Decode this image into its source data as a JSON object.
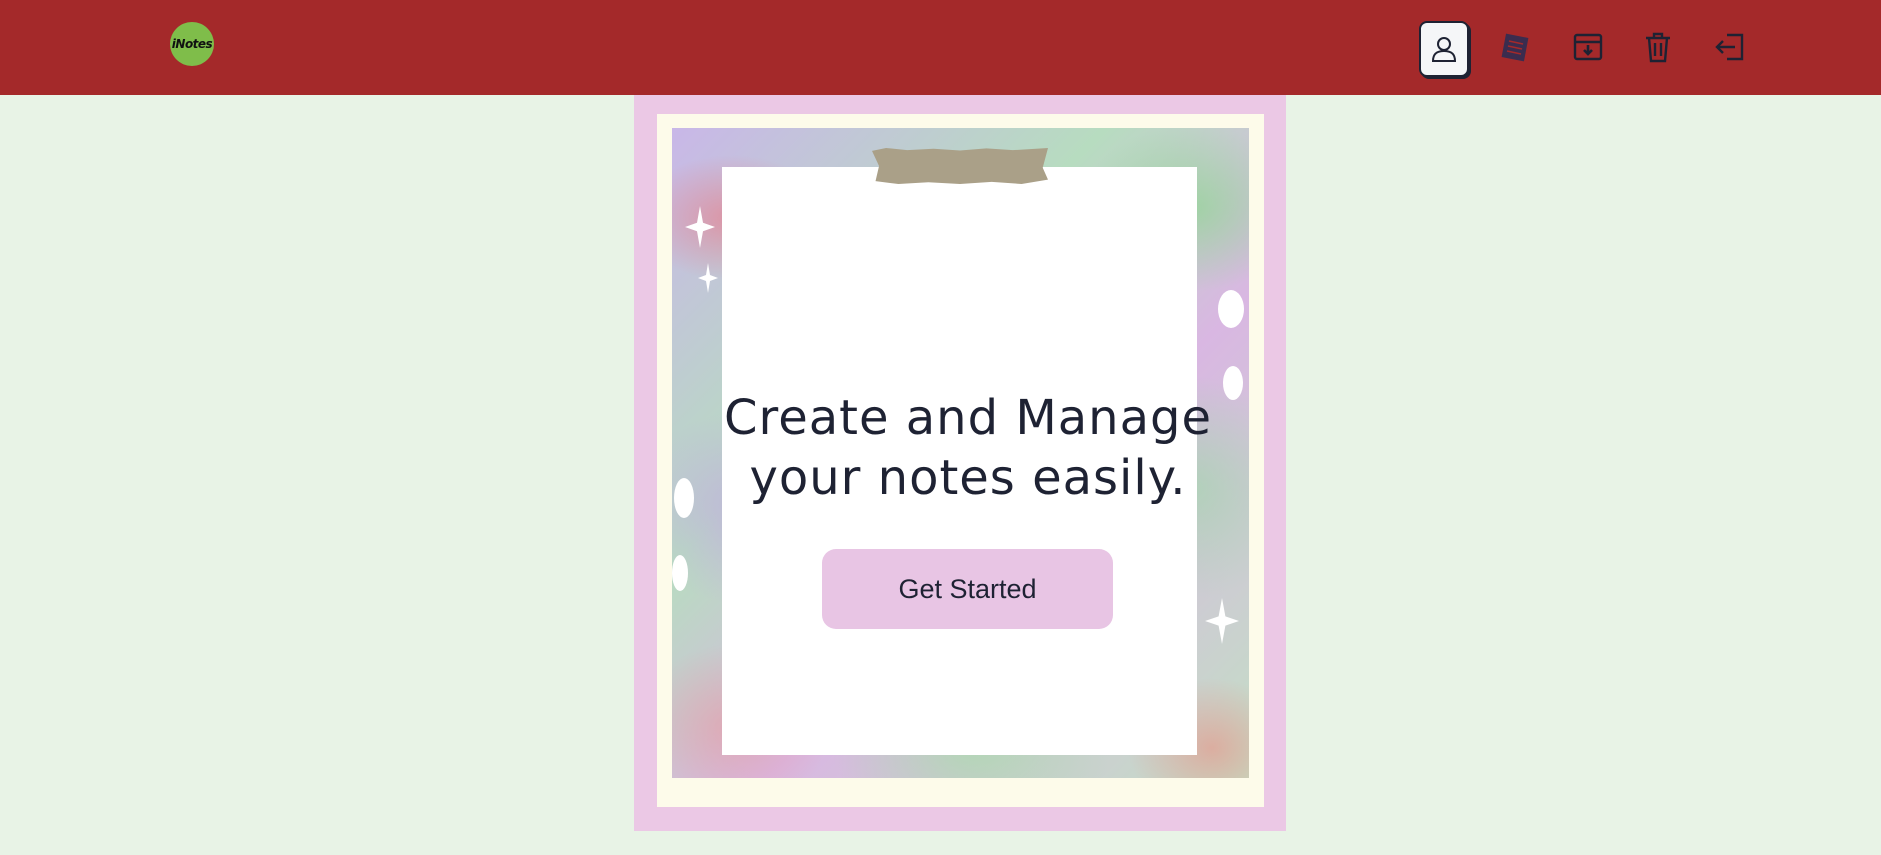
{
  "navbar": {
    "logo_text": "iNotes",
    "background": "#a4292a",
    "icons": [
      {
        "name": "profile-icon",
        "active": true
      },
      {
        "name": "notes-icon",
        "active": false
      },
      {
        "name": "archive-icon",
        "active": false
      },
      {
        "name": "trash-icon",
        "active": false
      },
      {
        "name": "logout-icon",
        "active": false
      }
    ]
  },
  "hero": {
    "headline_line1": "Create and Manage",
    "headline_line2": "your notes easily.",
    "cta_label": "Get Started"
  },
  "colors": {
    "page_background": "#e8f3e6",
    "frame_pink": "#ebc8e5",
    "cta_background": "#e8c5e4",
    "text_dark": "#1e2233"
  }
}
